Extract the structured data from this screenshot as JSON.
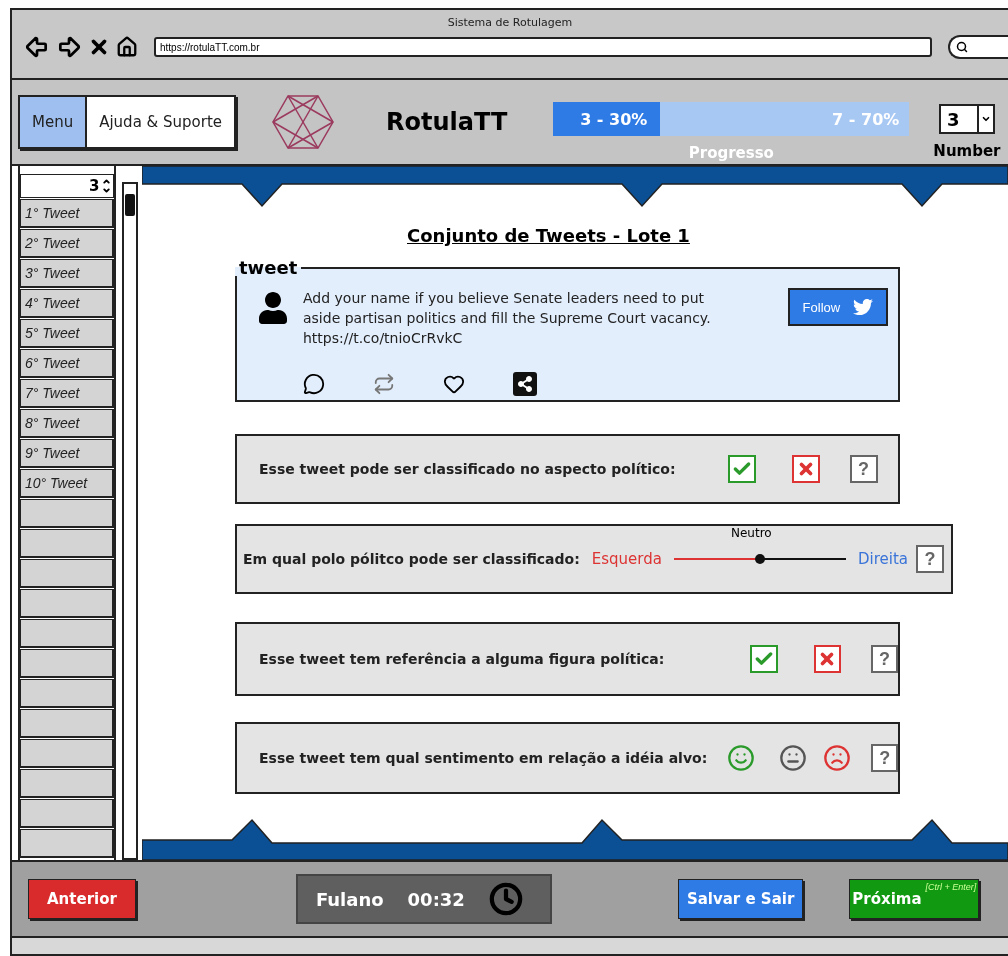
{
  "browser": {
    "title": "Sistema de Rotulagem",
    "url": "https://rotulaTT.com.br"
  },
  "header": {
    "menu": [
      {
        "label": "Menu",
        "selected": true
      },
      {
        "label": "Ajuda & Suporte",
        "selected": false
      }
    ],
    "app_name": "RotulaTT",
    "progress": {
      "level": 0.3,
      "done": "3 - 30%",
      "remaining": "7 - 70%",
      "label": "Progresso"
    },
    "number": {
      "value": "3",
      "label": "Number"
    }
  },
  "sidebar": {
    "spinner": "3",
    "items": [
      {
        "kind": "tweet",
        "label": "1° Tweet"
      },
      {
        "kind": "tweet",
        "label": "2° Tweet"
      },
      {
        "kind": "tweet",
        "label": "3° Tweet"
      },
      {
        "kind": "tweet",
        "label": "4° Tweet"
      },
      {
        "kind": "tweet",
        "label": "5° Tweet"
      },
      {
        "kind": "tweet",
        "label": "6° Tweet"
      },
      {
        "kind": "tweet",
        "label": "7° Tweet"
      },
      {
        "kind": "tweet",
        "label": "8° Tweet"
      },
      {
        "kind": "tweet",
        "label": "9° Tweet"
      },
      {
        "kind": "tweet",
        "label": "10° Tweet"
      },
      {
        "kind": "empty"
      },
      {
        "kind": "empty"
      },
      {
        "kind": "empty"
      },
      {
        "kind": "empty"
      },
      {
        "kind": "empty"
      },
      {
        "kind": "empty"
      },
      {
        "kind": "empty"
      },
      {
        "kind": "empty"
      },
      {
        "kind": "empty"
      },
      {
        "kind": "empty"
      },
      {
        "kind": "empty"
      },
      {
        "kind": "empty"
      }
    ]
  },
  "page_title": "Conjunto de Tweets - Lote 1",
  "tweet": {
    "legend": "tweet",
    "text": "Add your name if you believe Senate leaders need to put aside partisan politics and fill the Supreme Court vacancy. https://t.co/tnioCrRvkC",
    "follow": "Follow"
  },
  "questions": [
    {
      "kind": "yesno",
      "text": "Esse tweet pode ser classificado no aspecto político:",
      "help": "?"
    },
    {
      "kind": "scale",
      "text": "Em qual polo pólitco pode ser classificado:",
      "left": "Esquerda",
      "middle": "Neutro",
      "right": "Direita",
      "level": 0.5,
      "help": "?"
    },
    {
      "kind": "yesno",
      "text": "Esse tweet tem referência a alguma figura política:",
      "help": "?"
    },
    {
      "kind": "sentiment",
      "text": "Esse tweet tem qual sentimento em relação a idéia alvo:",
      "help": "?"
    }
  ],
  "footer": {
    "back": "Anterior",
    "user": "Fulano",
    "time": "00:32",
    "save": "Salvar e Sair",
    "next": "Próxima",
    "shortcut": "[Ctrl + Enter]"
  }
}
